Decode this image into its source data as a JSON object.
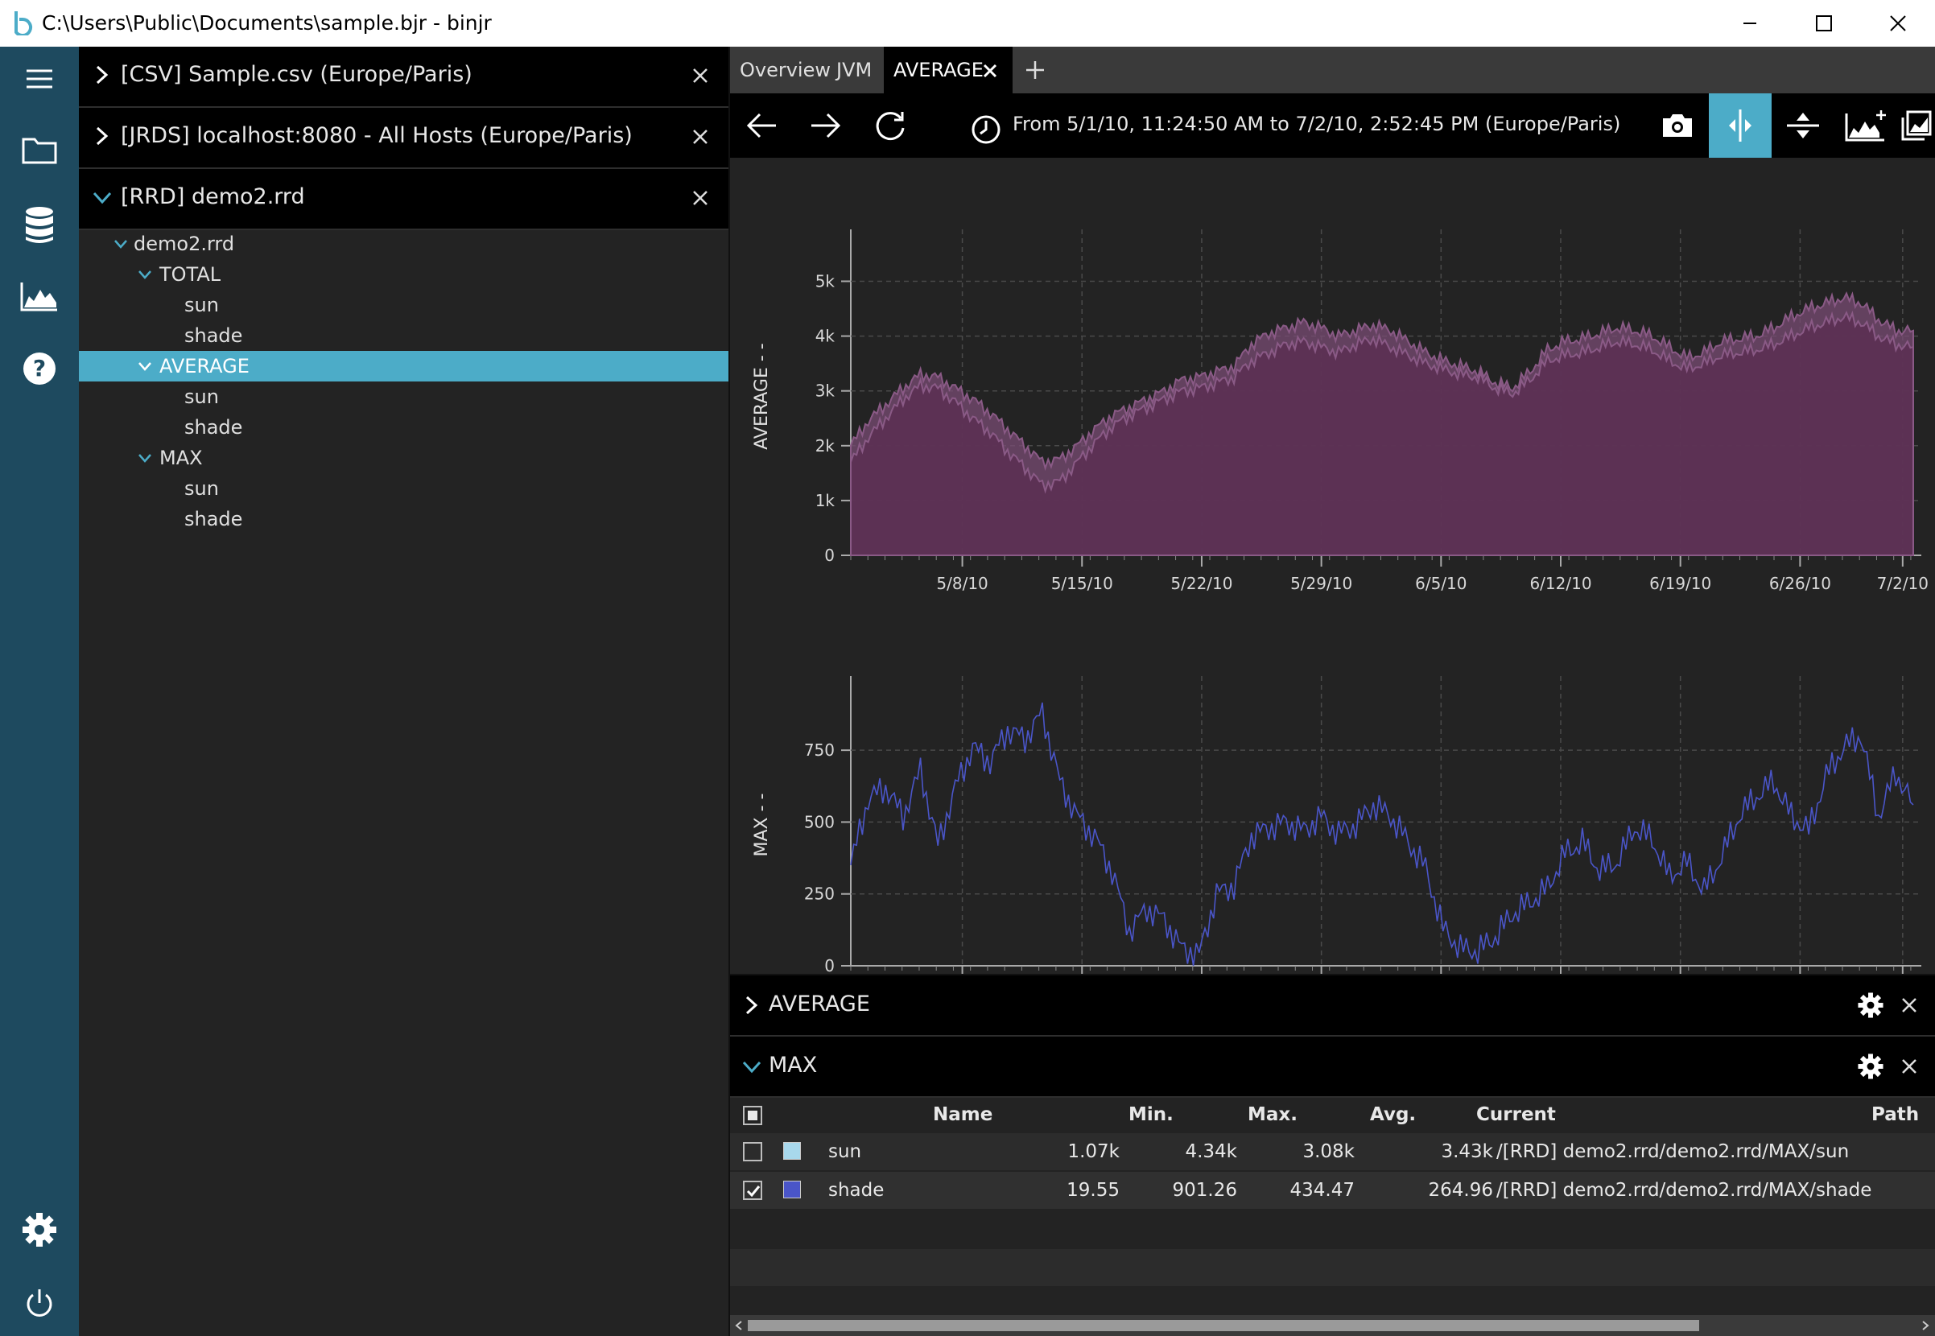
{
  "window": {
    "title": "C:\\Users\\Public\\Documents\\sample.bjr - binjr"
  },
  "sources": [
    {
      "label": "[CSV] Sample.csv (Europe/Paris)",
      "expanded": false
    },
    {
      "label": "[JRDS] localhost:8080 - All Hosts (Europe/Paris)",
      "expanded": false
    },
    {
      "label": "[RRD] demo2.rrd",
      "expanded": true
    }
  ],
  "tree": [
    {
      "label": "demo2.rrd",
      "level": 0,
      "expander": true
    },
    {
      "label": "TOTAL",
      "level": 1,
      "expander": true
    },
    {
      "label": "sun",
      "level": 2,
      "expander": false
    },
    {
      "label": "shade",
      "level": 2,
      "expander": false
    },
    {
      "label": "AVERAGE",
      "level": 1,
      "expander": true,
      "selected": true
    },
    {
      "label": "sun",
      "level": 2,
      "expander": false
    },
    {
      "label": "shade",
      "level": 2,
      "expander": false
    },
    {
      "label": "MAX",
      "level": 1,
      "expander": true
    },
    {
      "label": "sun",
      "level": 2,
      "expander": false
    },
    {
      "label": "shade",
      "level": 2,
      "expander": false
    }
  ],
  "tabs": [
    {
      "label": "Overview",
      "active": false
    },
    {
      "label": "JVM",
      "active": false
    },
    {
      "label": "AVERAGE",
      "active": true
    }
  ],
  "toolbar": {
    "time_range": "From 5/1/10, 11:24:50 AM to 7/2/10, 2:52:45 PM (Europe/Paris)"
  },
  "colors": {
    "accent": "#4cacc8",
    "rail": "#1e4a5f",
    "sun": "#a8d8ec",
    "shade": "#4a55c8",
    "avg_fill": "#5a2f52",
    "avg_line": "#8a5a86"
  },
  "chart_data": [
    {
      "type": "area",
      "ylabel": "AVERAGE - -",
      "x_ticks": [
        "5/8/10",
        "5/15/10",
        "5/22/10",
        "5/29/10",
        "6/5/10",
        "6/12/10",
        "6/19/10",
        "6/26/10",
        "7/2/10"
      ],
      "y_ticks": [
        "0",
        "1k",
        "2k",
        "3k",
        "4k",
        "5k"
      ],
      "ylim": [
        0,
        5800
      ],
      "x_range": [
        "5/1/10",
        "7/2/10"
      ],
      "series": [
        {
          "values": [
            1700,
            2150,
            2500,
            2850,
            3100,
            3050,
            2800,
            2500,
            2250,
            1900,
            1600,
            1280,
            1350,
            1700,
            2050,
            2350,
            2550,
            2700,
            2850,
            3000,
            3050,
            3150,
            3250,
            3550,
            3700,
            3850,
            3900,
            3800,
            3700,
            3850,
            3950,
            3800,
            3650,
            3500,
            3400,
            3300,
            3250,
            3050,
            2950,
            3200,
            3550,
            3650,
            3700,
            3800,
            3900,
            3850,
            3750,
            3550,
            3400,
            3500,
            3650,
            3700,
            3750,
            3850,
            4000,
            4150,
            4250,
            4350,
            4250,
            4000,
            3850,
            3800
          ]
        },
        {
          "values": [
            2000,
            2450,
            2750,
            3050,
            3300,
            3250,
            3050,
            2850,
            2600,
            2300,
            2000,
            1700,
            1750,
            2000,
            2300,
            2550,
            2700,
            2850,
            3000,
            3200,
            3250,
            3350,
            3450,
            3850,
            4050,
            4150,
            4250,
            4150,
            4000,
            4100,
            4200,
            4100,
            3900,
            3700,
            3550,
            3450,
            3350,
            3150,
            3050,
            3350,
            3750,
            3900,
            3950,
            4050,
            4150,
            4100,
            4000,
            3800,
            3600,
            3700,
            3900,
            3950,
            4000,
            4150,
            4350,
            4500,
            4600,
            4700,
            4600,
            4300,
            4100,
            4100
          ]
        }
      ]
    },
    {
      "type": "line",
      "ylabel": "MAX - -",
      "x_ticks": [
        "5/8/10",
        "5/15/10",
        "5/22/10",
        "5/29/10",
        "6/5/10",
        "6/12/10",
        "6/19/10",
        "6/26/10",
        "7/2/10"
      ],
      "y_ticks": [
        "0",
        "250",
        "500",
        "750"
      ],
      "ylim": [
        0,
        980
      ],
      "x_range": [
        "5/1/10",
        "7/2/10"
      ],
      "series": [
        {
          "name": "shade",
          "values": [
            350,
            580,
            620,
            520,
            680,
            420,
            620,
            760,
            710,
            820,
            790,
            880,
            640,
            520,
            450,
            330,
            120,
            200,
            160,
            60,
            40,
            250,
            280,
            450,
            480,
            500,
            470,
            520,
            460,
            490,
            560,
            520,
            430,
            340,
            130,
            60,
            50,
            100,
            180,
            220,
            270,
            390,
            430,
            330,
            360,
            480,
            440,
            310,
            360,
            260,
            380,
            520,
            590,
            640,
            520,
            470,
            660,
            760,
            800,
            520,
            670,
            560
          ]
        }
      ]
    }
  ],
  "panels": [
    {
      "label": "AVERAGE",
      "expanded": false
    },
    {
      "label": "MAX",
      "expanded": true
    }
  ],
  "table": {
    "headers": {
      "name": "Name",
      "min": "Min.",
      "max": "Max.",
      "avg": "Avg.",
      "current": "Current",
      "path": "Path"
    },
    "rows": [
      {
        "checked": false,
        "color": "#a8d8ec",
        "name": "sun",
        "min": "1.07k",
        "max": "4.34k",
        "avg": "3.08k",
        "current": "3.43k",
        "path": "/[RRD] demo2.rrd/demo2.rrd/MAX/sun"
      },
      {
        "checked": true,
        "color": "#4a55c8",
        "name": "shade",
        "min": "19.55",
        "max": "901.26",
        "avg": "434.47",
        "current": "264.96",
        "path": "/[RRD] demo2.rrd/demo2.rrd/MAX/shade"
      }
    ]
  }
}
